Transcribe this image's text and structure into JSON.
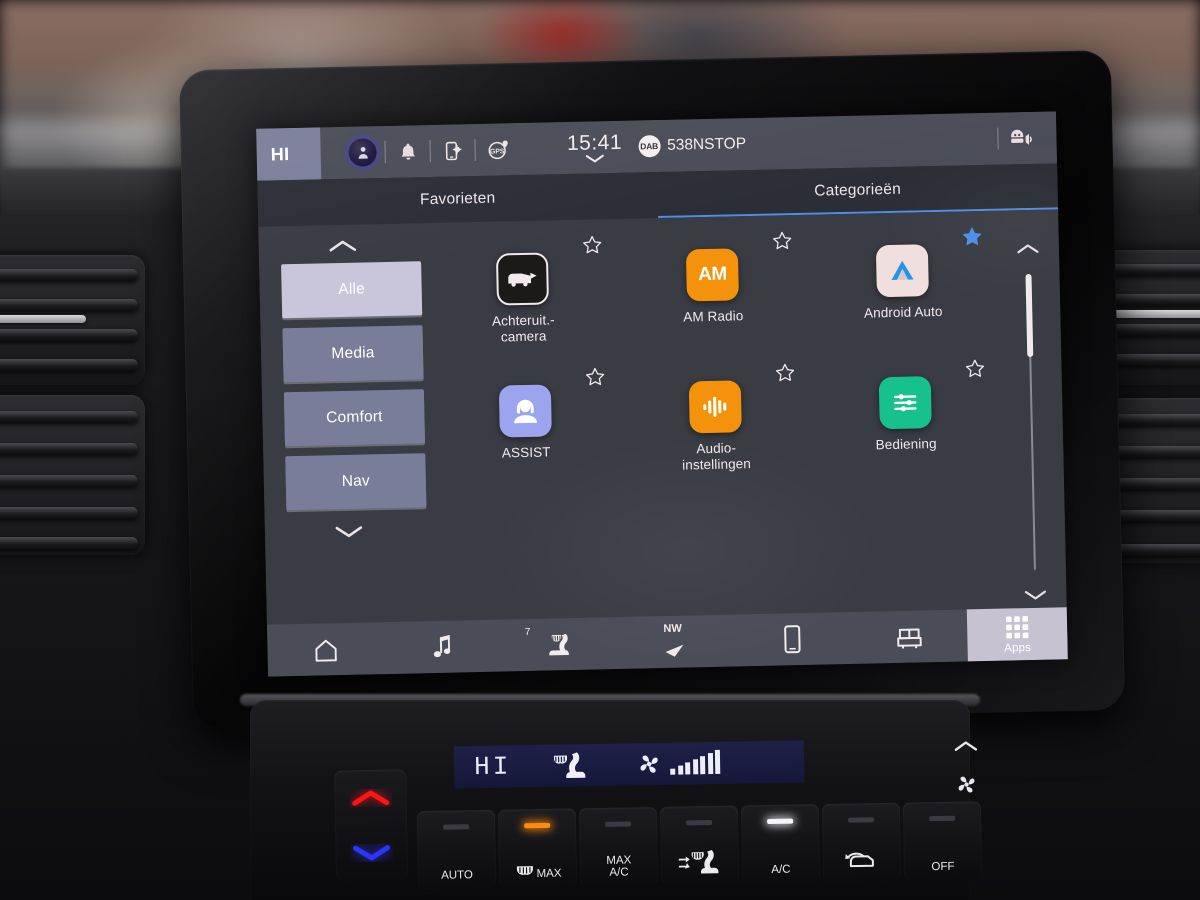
{
  "screen": {
    "status_bar": {
      "hi_label": "HI",
      "icons": [
        {
          "name": "profile-icon",
          "label": "profile"
        },
        {
          "name": "bell-icon",
          "label": "notifications"
        },
        {
          "name": "phone-settings-icon",
          "label": "device settings"
        },
        {
          "name": "gps-icon",
          "label": "GPS"
        }
      ],
      "clock": "15:41",
      "dab_badge": "DAB",
      "station": "538NSTOP",
      "right_icon": "voice-assistant-icon"
    },
    "tabs": [
      {
        "label": "Favorieten",
        "active": false
      },
      {
        "label": "Categorieën",
        "active": true
      }
    ],
    "categories": [
      {
        "label": "Alle",
        "active": true
      },
      {
        "label": "Media",
        "active": false
      },
      {
        "label": "Comfort",
        "active": false
      },
      {
        "label": "Nav",
        "active": false
      }
    ],
    "apps": [
      [
        {
          "label": "Achteruit.-\ncamera",
          "icon": "rear-camera-icon",
          "favorite": false,
          "bg": "#1c1a18"
        },
        {
          "label": "AM Radio",
          "icon": "am-radio-icon",
          "favorite": false,
          "bg": "#f5920b"
        },
        {
          "label": "Android Auto",
          "icon": "android-auto-icon",
          "favorite": true,
          "bg": "#f0dfdc"
        }
      ],
      [
        {
          "label": "ASSIST",
          "icon": "assist-headset-icon",
          "favorite": false,
          "bg": "#9aa5ee"
        },
        {
          "label": "Audio-\ninstellingen",
          "icon": "audio-waveform-icon",
          "favorite": false,
          "bg": "#f5920b"
        },
        {
          "label": "Bediening",
          "icon": "settings-sliders-icon",
          "favorite": false,
          "bg": "#16c18c"
        }
      ]
    ],
    "bottom_nav": [
      {
        "name": "home",
        "icon": "home-icon"
      },
      {
        "name": "media",
        "icon": "music-note-icon"
      },
      {
        "name": "climate",
        "icon": "seat-heating-icon",
        "temperature": "7"
      },
      {
        "name": "navigation",
        "icon": "compass-arrow-icon",
        "heading": "NW"
      },
      {
        "name": "phone",
        "icon": "phone-icon"
      },
      {
        "name": "vehicle",
        "icon": "vehicle-icon"
      },
      {
        "name": "apps",
        "icon": "apps-grid-icon",
        "label": "Apps",
        "active": true
      }
    ],
    "accent_color": "#4d8ee8",
    "favorite_color": "#4d8ee8"
  },
  "climate_panel": {
    "display": "HI",
    "fan_bars": 7,
    "buttons": [
      {
        "label": "AUTO",
        "led": "off"
      },
      {
        "label": "MAX",
        "icon": "rear-defrost-icon",
        "led": "amber"
      },
      {
        "label": "MAX\nA/C",
        "led": "off"
      },
      {
        "label": "",
        "icon": "front-defrost-icon",
        "led": "off"
      },
      {
        "label": "A/C",
        "led": "white"
      },
      {
        "label": "",
        "icon": "recirculation-icon",
        "led": "off"
      },
      {
        "label": "OFF",
        "led": "off"
      }
    ],
    "temp_up": "temperature-up-arrow",
    "temp_down": "temperature-down-arrow",
    "fan_up": "fan-speed-up",
    "fan_down": "fan-speed-down"
  }
}
